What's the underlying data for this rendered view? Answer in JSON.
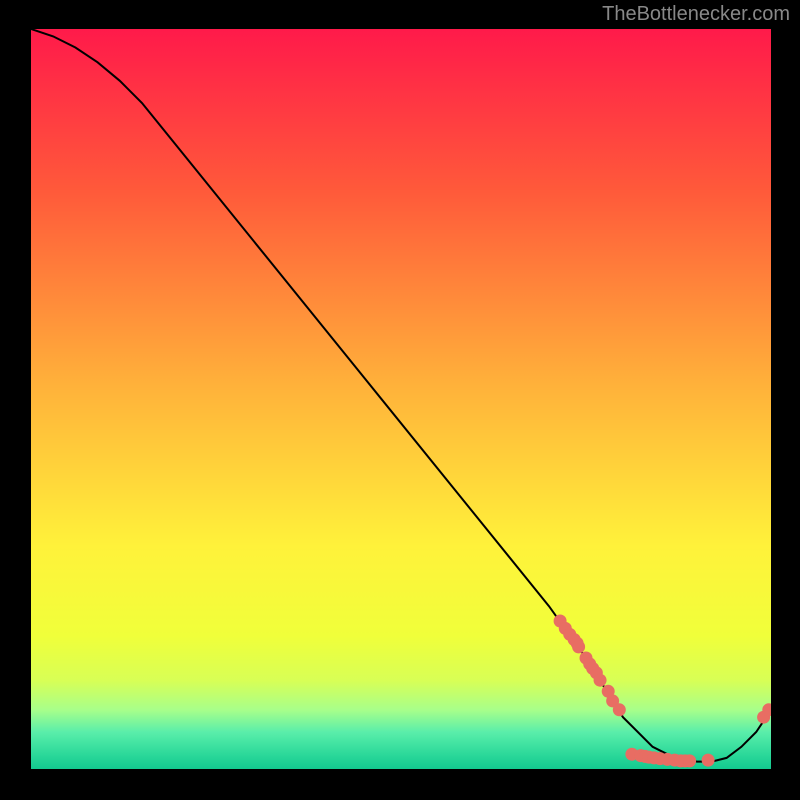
{
  "watermark": "TheBottlenecker.com",
  "chart_data": {
    "type": "line",
    "title": "",
    "xlabel": "",
    "ylabel": "",
    "xlim": [
      0,
      100
    ],
    "ylim": [
      0,
      100
    ],
    "gradient_stops": [
      {
        "offset": 0.0,
        "color": "#ff1a4a"
      },
      {
        "offset": 0.22,
        "color": "#ff5a3a"
      },
      {
        "offset": 0.48,
        "color": "#ffb13a"
      },
      {
        "offset": 0.7,
        "color": "#fff23a"
      },
      {
        "offset": 0.82,
        "color": "#f0ff3a"
      },
      {
        "offset": 0.88,
        "color": "#d8ff55"
      },
      {
        "offset": 0.92,
        "color": "#a8ff8a"
      },
      {
        "offset": 0.95,
        "color": "#5aeeaa"
      },
      {
        "offset": 0.98,
        "color": "#2cd99a"
      },
      {
        "offset": 1.0,
        "color": "#13c98f"
      }
    ],
    "curve": [
      {
        "x": 0,
        "y": 100
      },
      {
        "x": 3,
        "y": 99
      },
      {
        "x": 6,
        "y": 97.5
      },
      {
        "x": 9,
        "y": 95.5
      },
      {
        "x": 12,
        "y": 93
      },
      {
        "x": 15,
        "y": 90
      },
      {
        "x": 70,
        "y": 22
      },
      {
        "x": 75,
        "y": 15
      },
      {
        "x": 80,
        "y": 7
      },
      {
        "x": 84,
        "y": 3
      },
      {
        "x": 87,
        "y": 1.5
      },
      {
        "x": 90,
        "y": 1
      },
      {
        "x": 92,
        "y": 1
      },
      {
        "x": 94,
        "y": 1.5
      },
      {
        "x": 96,
        "y": 3
      },
      {
        "x": 98,
        "y": 5
      },
      {
        "x": 100,
        "y": 8
      }
    ],
    "points": [
      {
        "x": 71.5,
        "y": 20.0
      },
      {
        "x": 72.2,
        "y": 19.0
      },
      {
        "x": 72.8,
        "y": 18.2
      },
      {
        "x": 73.4,
        "y": 17.5
      },
      {
        "x": 73.8,
        "y": 17.0
      },
      {
        "x": 74.0,
        "y": 16.5
      },
      {
        "x": 75.0,
        "y": 15.0
      },
      {
        "x": 75.5,
        "y": 14.2
      },
      {
        "x": 75.9,
        "y": 13.6
      },
      {
        "x": 76.4,
        "y": 13.0
      },
      {
        "x": 76.9,
        "y": 12.0
      },
      {
        "x": 78.0,
        "y": 10.5
      },
      {
        "x": 78.6,
        "y": 9.2
      },
      {
        "x": 79.5,
        "y": 8.0
      },
      {
        "x": 81.2,
        "y": 2.0
      },
      {
        "x": 82.4,
        "y": 1.8
      },
      {
        "x": 83.0,
        "y": 1.7
      },
      {
        "x": 83.5,
        "y": 1.6
      },
      {
        "x": 84.2,
        "y": 1.5
      },
      {
        "x": 85.0,
        "y": 1.4
      },
      {
        "x": 86.0,
        "y": 1.3
      },
      {
        "x": 87.0,
        "y": 1.2
      },
      {
        "x": 87.8,
        "y": 1.1
      },
      {
        "x": 88.4,
        "y": 1.1
      },
      {
        "x": 89.0,
        "y": 1.1
      },
      {
        "x": 91.5,
        "y": 1.2
      },
      {
        "x": 99.0,
        "y": 7.0
      },
      {
        "x": 99.7,
        "y": 8.0
      }
    ],
    "point_color": "#e86d63",
    "line_color": "#000000"
  }
}
